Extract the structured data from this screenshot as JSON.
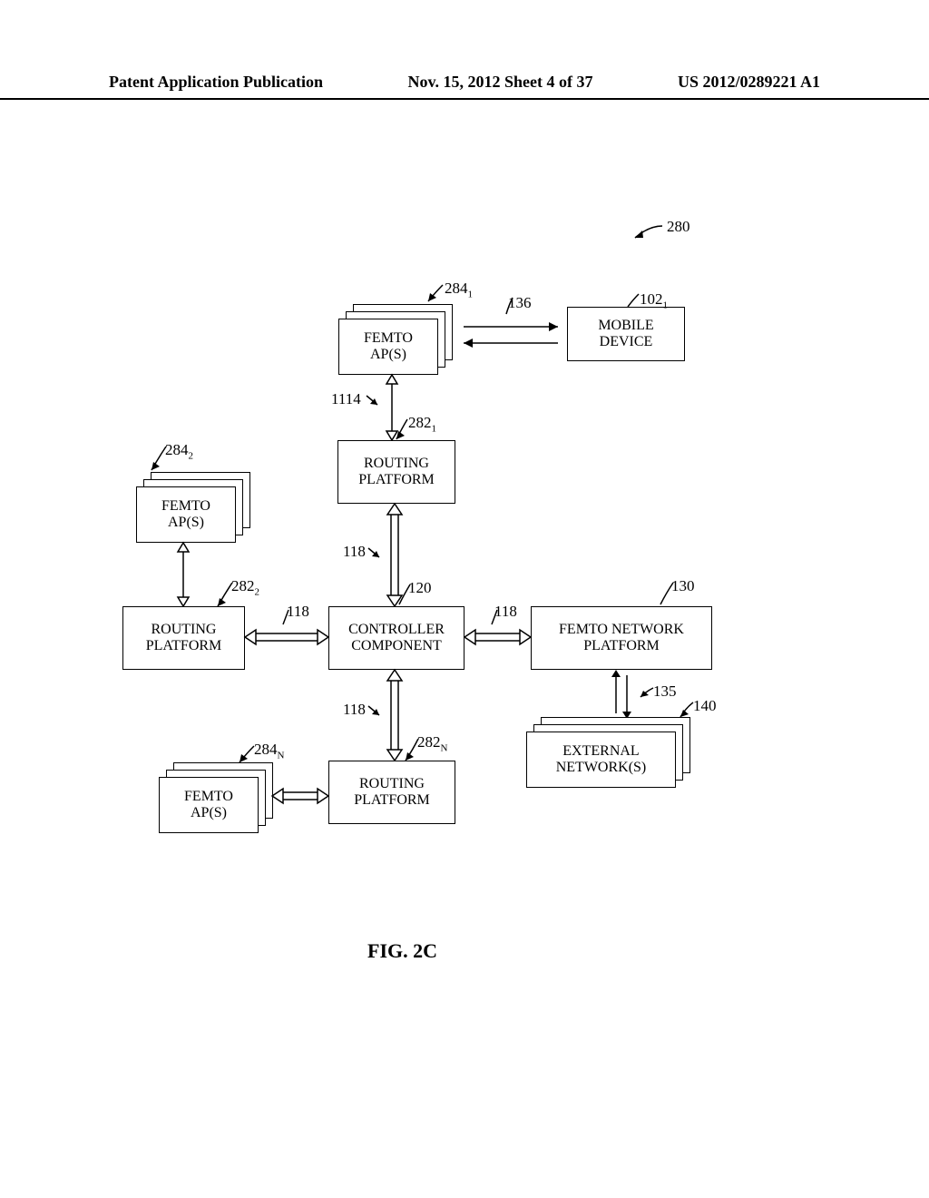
{
  "header": {
    "left": "Patent Application Publication",
    "center": "Nov. 15, 2012  Sheet 4 of 37",
    "right": "US 2012/0289221 A1"
  },
  "figure": {
    "caption": "FIG. 2C"
  },
  "labels": {
    "ref_280": "280",
    "ref_284_1": "284",
    "sub_1a": "1",
    "ref_136": "136",
    "ref_102_1": "102",
    "sub_1b": "1",
    "ref_1114": "1114",
    "ref_282_1": "282",
    "sub_1c": "1",
    "ref_284_2": "284",
    "sub_2a": "2",
    "ref_118_top": "118",
    "ref_282_2": "282",
    "sub_2b": "2",
    "ref_120": "120",
    "ref_130": "130",
    "ref_118_left": "118",
    "ref_118_right": "118",
    "ref_135": "135",
    "ref_140": "140",
    "ref_118_bottom": "118",
    "ref_282_N": "282",
    "sub_Na": "N",
    "ref_284_N": "284",
    "sub_Nb": "N"
  },
  "blocks": {
    "femto_aps_1": "FEMTO\nAP(S)",
    "mobile_device": "MOBILE\nDEVICE",
    "routing_platform_1": "ROUTING\nPLATFORM",
    "femto_aps_2": "FEMTO\nAP(S)",
    "routing_platform_2": "ROUTING\nPLATFORM",
    "controller_component": "CONTROLLER\nCOMPONENT",
    "femto_network_platform": "FEMTO NETWORK\nPLATFORM",
    "routing_platform_N": "ROUTING\nPLATFORM",
    "femto_aps_N": "FEMTO\nAP(S)",
    "external_networks": "EXTERNAL\nNETWORK(S)"
  }
}
